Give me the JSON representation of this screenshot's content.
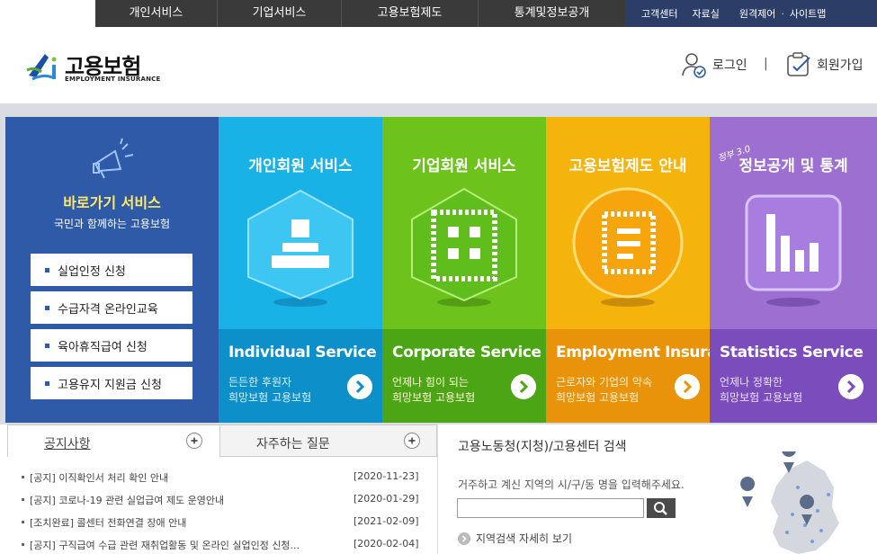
{
  "topnav": {
    "menu": [
      "개인서비스",
      "기업서비스",
      "고용보험제도",
      "통계및정보공개"
    ],
    "util": [
      "고객센터",
      "자료실",
      "원격제어",
      "사이트맵"
    ],
    "util_separator": "·"
  },
  "header": {
    "logo_text": "고용보험",
    "logo_sub": "EMPLOYMENT INSURANCE",
    "login_label": "로그인",
    "separator": "|",
    "join_label": "회원가입"
  },
  "quick": {
    "title": "바로가기 서비스",
    "subtitle": "국민과 함께하는 고용보험",
    "items": [
      "실업인정 신청",
      "수급자격 온라인교육",
      "육아휴직급여 신청",
      "고용유지 지원금 신청"
    ]
  },
  "services": [
    {
      "title": "개인회원 서비스",
      "en": "Individual Service",
      "desc1": "든든한 후원자",
      "desc2": "희망보험 고용보험"
    },
    {
      "title": "기업회원 서비스",
      "en": "Corporate Service",
      "desc1": "언제나 힘이 되는",
      "desc2": "희망보험 고용보험"
    },
    {
      "title": "고용보험제도 안내",
      "en": "Employment Insurance",
      "desc1": "근로자와 기업의 약속",
      "desc2": "희망보험 고용보험"
    },
    {
      "title": "정보공개 및 통계",
      "en": "Statistics Service",
      "desc1": "언제나 정확한",
      "desc2": "희망보험 고용보험",
      "handwrite": "정부 3.0"
    }
  ],
  "colors": {
    "individual_top": "#19b2e6",
    "individual_bottom": "#0d8fc9",
    "corporate_top": "#6ec21c",
    "corporate_bottom": "#4ca515",
    "insurance_top": "#f5b40c",
    "insurance_bottom": "#e8930a",
    "statistics_top": "#9c6fd1",
    "statistics_bottom": "#7b4cbc",
    "quick_bg": "#2f5aa8"
  },
  "notice": {
    "tab_notice": "공지사항",
    "tab_faq": "자주하는 질문",
    "rows": [
      {
        "text": "[공지] 이직확인서 처리 확인 안내",
        "date": "[2020-11-23]"
      },
      {
        "text": "[공지] 코로나-19 관련 실업급여 제도 운영안내",
        "date": "[2020-01-29]"
      },
      {
        "text": "[조치완료] 콜센터 전화연결 장애 안내",
        "date": "[2021-02-09]"
      },
      {
        "text": "[공지] 구직급여 수급 관련 재취업활동 및 온라인 실업인정 신청...",
        "date": "[2020-02-04]"
      }
    ]
  },
  "center_search": {
    "title": "고용노동청(지청)/고용센터 검색",
    "hint": "거주하고 계신 지역의 시/구/동 명을 입력해주세요.",
    "input_value": "",
    "more_label": "지역검색 자세히 보기"
  }
}
